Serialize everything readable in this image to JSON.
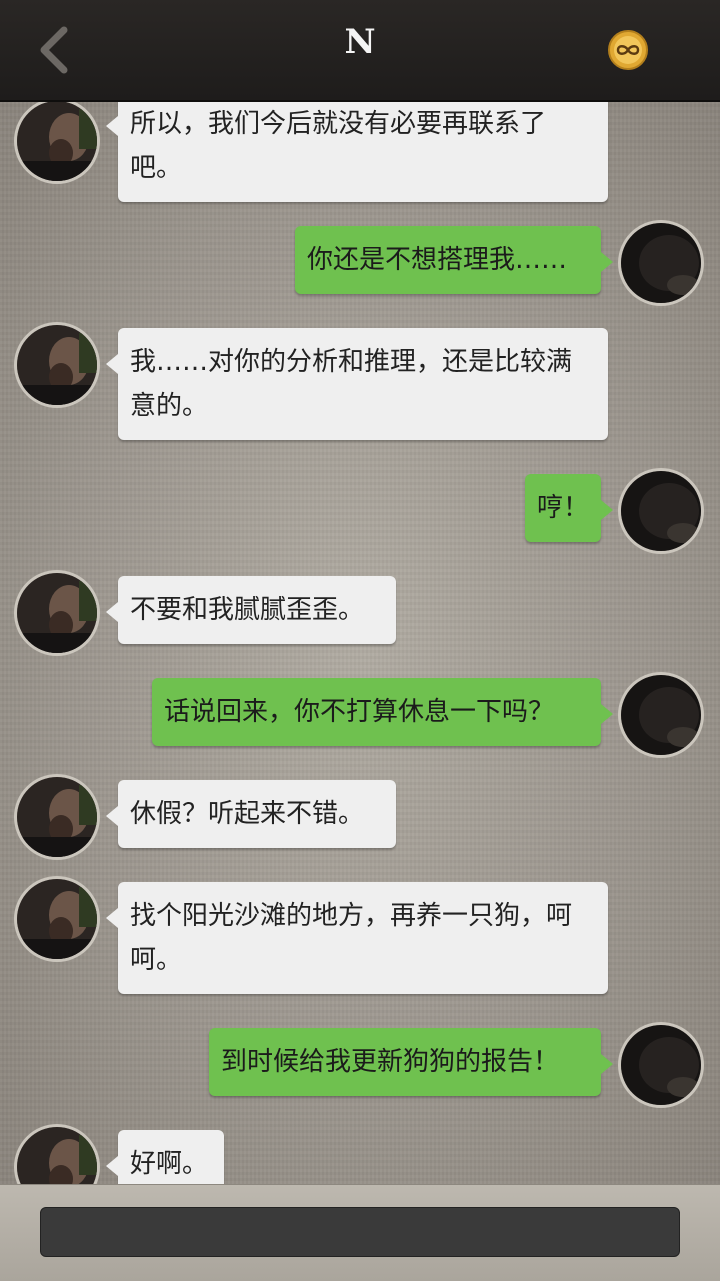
{
  "header": {
    "title": "N",
    "back_icon": "chevron-left-icon",
    "action_icon": "infinity-coin-icon"
  },
  "messages": [
    {
      "side": "left",
      "text": "所以，我们今后就没有必要再联系了吧。"
    },
    {
      "side": "right",
      "text": "你还是不想搭理我……"
    },
    {
      "side": "left",
      "text": "我……对你的分析和推理，还是比较满意的。"
    },
    {
      "side": "right",
      "text": "哼！"
    },
    {
      "side": "left",
      "text": "不要和我腻腻歪歪。"
    },
    {
      "side": "right",
      "text": "话说回来，你不打算休息一下吗？"
    },
    {
      "side": "left",
      "text": "休假？听起来不错。"
    },
    {
      "side": "left",
      "text": "找个阳光沙滩的地方，再养一只狗，呵呵。"
    },
    {
      "side": "right",
      "text": "到时候给我更新狗狗的报告！"
    },
    {
      "side": "left",
      "text": "好啊。"
    }
  ],
  "input": {
    "value": ""
  },
  "colors": {
    "header_bg": "#221f1e",
    "left_bubble": "#efefef",
    "right_bubble": "#6fc14f",
    "input_bg": "#3a3a3a"
  }
}
